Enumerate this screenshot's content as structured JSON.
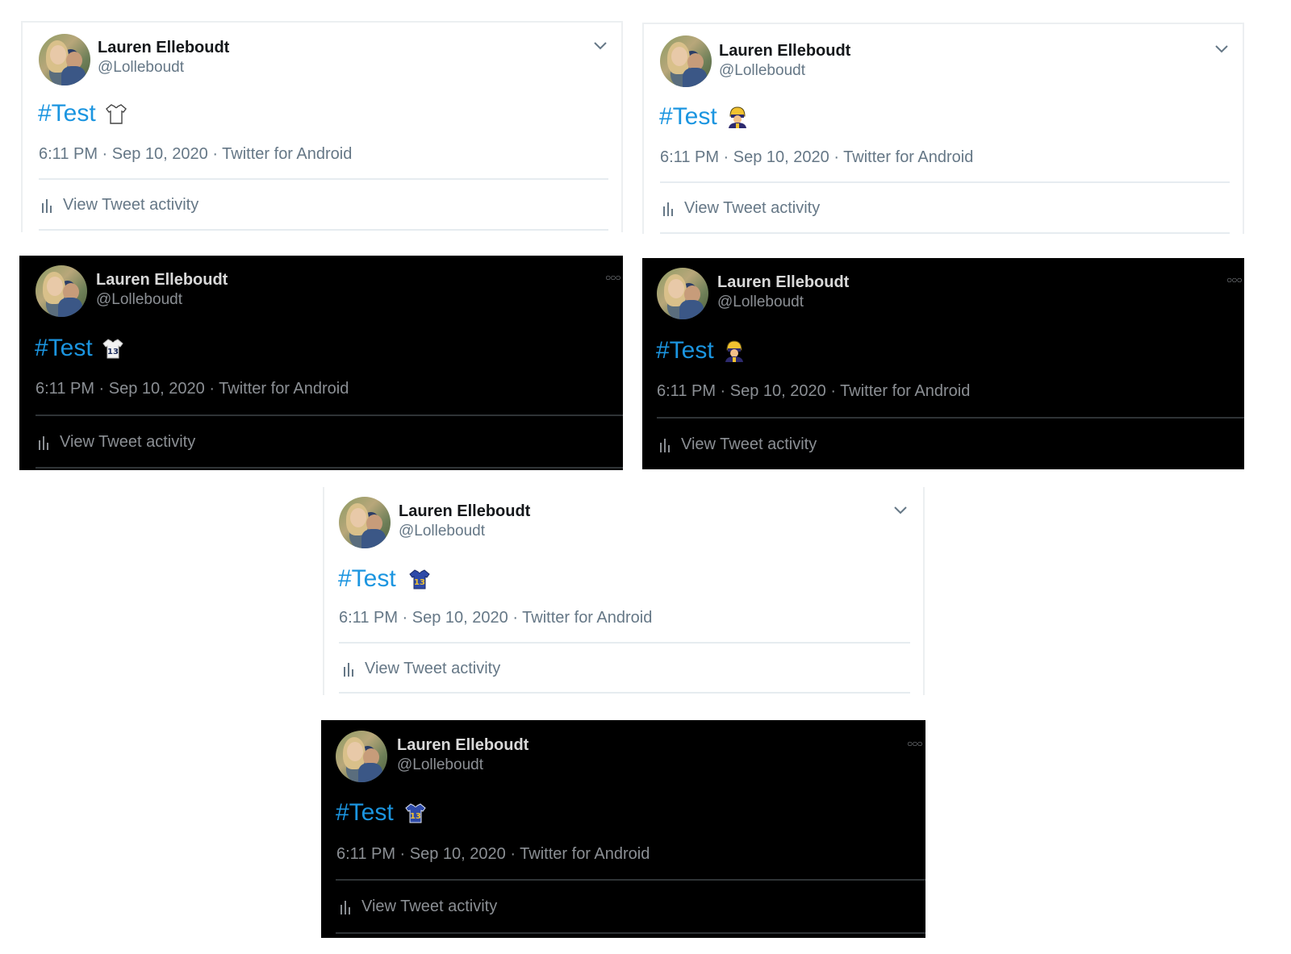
{
  "colors": {
    "hashtag": "#1b95e0",
    "dark_bg": "#000000",
    "light_bg": "#ffffff"
  },
  "tweets": [
    {
      "theme": "light",
      "author": {
        "name": "Lauren Elleboudt",
        "handle": "@Lolleboudt"
      },
      "text": "#Test",
      "emoji": "jersey-outline-icon",
      "timestamp": "6:11 PM · Sep 10, 2020 · Twitter for Android",
      "activity_label": "View Tweet activity",
      "menu_icon": "chevron-down-icon"
    },
    {
      "theme": "light",
      "author": {
        "name": "Lauren Elleboudt",
        "handle": "@Lolleboudt"
      },
      "text": "#Test",
      "emoji": "football-player-icon",
      "timestamp": "6:11 PM · Sep 10, 2020 · Twitter for Android",
      "activity_label": "View Tweet activity",
      "menu_icon": "chevron-down-icon"
    },
    {
      "theme": "dark",
      "author": {
        "name": "Lauren Elleboudt",
        "handle": "@Lolleboudt"
      },
      "text": "#Test",
      "emoji": "jersey-13-white-icon",
      "timestamp": "6:11 PM · Sep 10, 2020 · Twitter for Android",
      "activity_label": "View Tweet activity",
      "menu_icon": "more-dots-icon"
    },
    {
      "theme": "dark",
      "author": {
        "name": "Lauren Elleboudt",
        "handle": "@Lolleboudt"
      },
      "text": "#Test",
      "emoji": "football-player-icon",
      "timestamp": "6:11 PM · Sep 10, 2020 · Twitter for Android",
      "activity_label": "View Tweet activity",
      "menu_icon": "more-dots-icon"
    },
    {
      "theme": "light",
      "author": {
        "name": "Lauren Elleboudt",
        "handle": "@Lolleboudt"
      },
      "text": "#Test",
      "emoji": "jersey-13-blue-icon",
      "timestamp": "6:11 PM · Sep 10, 2020 · Twitter for Android",
      "activity_label": "View Tweet activity",
      "menu_icon": "chevron-down-icon"
    },
    {
      "theme": "dark",
      "author": {
        "name": "Lauren Elleboudt",
        "handle": "@Lolleboudt"
      },
      "text": "#Test",
      "emoji": "jersey-13-blue-icon",
      "timestamp": "6:11 PM · Sep 10, 2020 · Twitter for Android",
      "activity_label": "View Tweet activity",
      "menu_icon": "more-dots-icon"
    }
  ]
}
